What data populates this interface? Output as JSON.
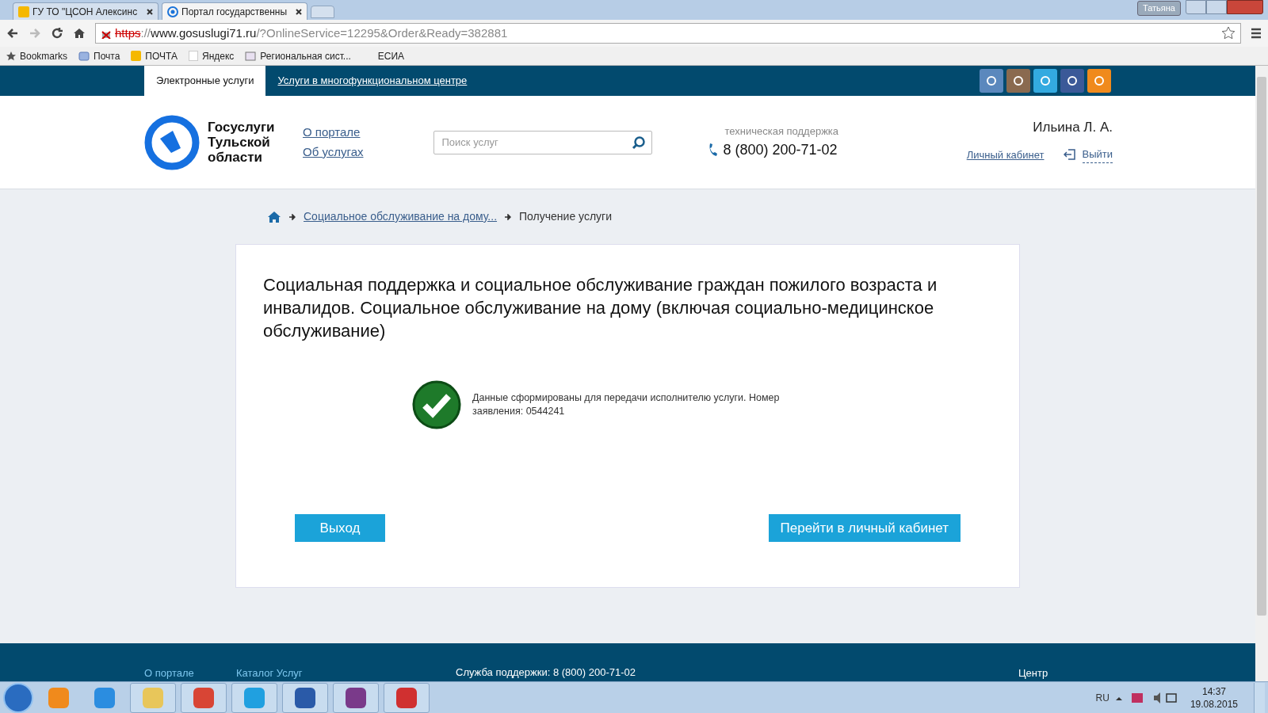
{
  "browser": {
    "tabs": [
      {
        "label": "ГУ ТО \"ЦСОН Алексинс",
        "selected": false
      },
      {
        "label": "Портал государственны",
        "selected": true
      }
    ],
    "profile": "Татьяна",
    "url_host": "https://www.gosuslugi71.ru",
    "url_rest": "/?OnlineService=12295&Order&Ready=382881",
    "bookmarks": [
      {
        "label": "Bookmarks"
      },
      {
        "label": "Почта"
      },
      {
        "label": "ПОЧТА"
      },
      {
        "label": "Яндекс"
      },
      {
        "label": "Региональная сист..."
      },
      {
        "label": "ЕСИА"
      }
    ]
  },
  "site": {
    "top_tabs": [
      {
        "label": "Электронные услуги",
        "selected": true
      },
      {
        "label": "Услуги в многофункциональном центре",
        "selected": false
      }
    ],
    "logo_text": "Госуслуги Тульской области",
    "nav_links": [
      "О портале",
      "Об услугах"
    ],
    "search": {
      "placeholder": "Поиск услуг"
    },
    "support": {
      "label": "техническая поддержка",
      "phone": "8 (800) 200-71-02"
    },
    "user": {
      "name": "Ильина Л. А.",
      "cabinet_link": "Личный кабинет",
      "logout_link": "Выйти"
    },
    "breadcrumbs": [
      "Социальное обслуживание на дому...",
      "Получение услуги"
    ],
    "card": {
      "title": "Социальная поддержка и социальное обслуживание граждан пожилого возраста и инвалидов. Социальное обслуживание на дому (включая социально-медицинское обслуживание)",
      "message": "Данные сформированы для передачи исполнителю услуги. Номер заявления: 0544241",
      "buttons": [
        "Выход",
        "Перейти в личный кабинет"
      ]
    },
    "footer": {
      "links": [
        "О портале",
        "Каталог Услуг"
      ],
      "support": "Служба поддержки: 8 (800) 200-71-02",
      "column_3": "Центр"
    }
  },
  "taskbar": {
    "language": "RU",
    "time": "14:37",
    "date": "19.08.2015"
  }
}
